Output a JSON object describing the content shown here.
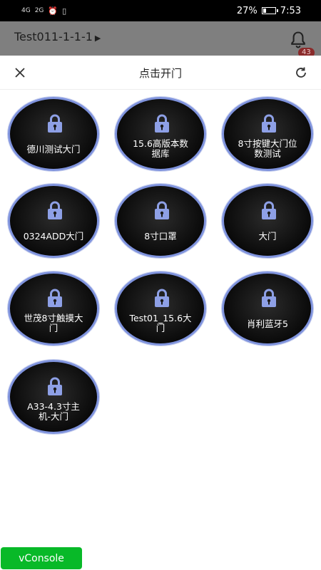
{
  "status_bar": {
    "network_left": "4G",
    "network_right": "2G",
    "battery_text": "27%",
    "battery_level": 0.27,
    "time": "7:53"
  },
  "app_header": {
    "title": "Test011-1-1-1",
    "notification_count": "43"
  },
  "sheet": {
    "title": "点击开门"
  },
  "doors": [
    {
      "label": "德川测试大门"
    },
    {
      "label": "15.6高版本数据库"
    },
    {
      "label": "8寸按键大门位数测试"
    },
    {
      "label": "0324ADD大门"
    },
    {
      "label": "8寸口罩"
    },
    {
      "label": "大门"
    },
    {
      "label": "世茂8寸触摸大门"
    },
    {
      "label": "Test01_15.6大门"
    },
    {
      "label": "肖利蓝牙5"
    },
    {
      "label": "A33-4.3寸主机-大门"
    }
  ],
  "vconsole": {
    "label": "vConsole"
  },
  "colors": {
    "door_ring": "#7f93dd",
    "lock_icon": "#8ea0e6",
    "vconsole_bg": "#08b928"
  }
}
